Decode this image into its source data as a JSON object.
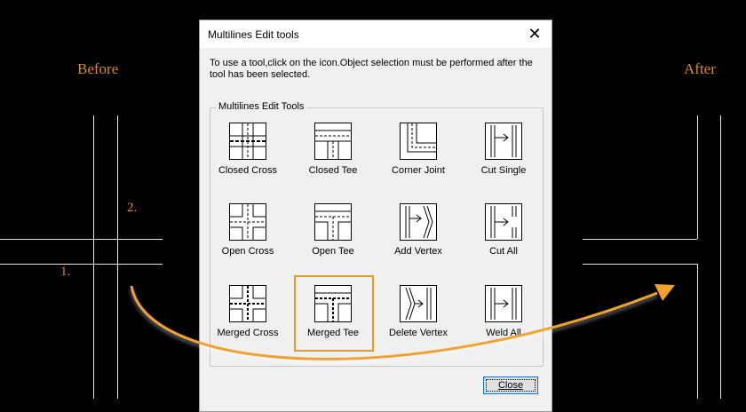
{
  "labels": {
    "before": "Before",
    "after": "After",
    "step1": "1.",
    "step2": "2."
  },
  "dialog": {
    "title": "Multilines Edit tools",
    "close_glyph": "✕",
    "instructions": "To use a tool,click on the icon.Object selection must be performed after the tool has been selected.",
    "group_label": "Multilines Edit Tools",
    "tools": [
      {
        "label": "Closed Cross",
        "icon": "closed-cross-icon"
      },
      {
        "label": "Closed Tee",
        "icon": "closed-tee-icon"
      },
      {
        "label": "Corner Joint",
        "icon": "corner-joint-icon"
      },
      {
        "label": "Cut Single",
        "icon": "cut-single-icon"
      },
      {
        "label": "Open Cross",
        "icon": "open-cross-icon"
      },
      {
        "label": "Open Tee",
        "icon": "open-tee-icon"
      },
      {
        "label": "Add Vertex",
        "icon": "add-vertex-icon"
      },
      {
        "label": "Cut All",
        "icon": "cut-all-icon"
      },
      {
        "label": "Merged Cross",
        "icon": "merged-cross-icon"
      },
      {
        "label": "Merged Tee",
        "icon": "merged-tee-icon"
      },
      {
        "label": "Delete Vertex",
        "icon": "delete-vertex-icon"
      },
      {
        "label": "Weld All",
        "icon": "weld-all-icon"
      }
    ],
    "selected_tool": "Merged Tee",
    "close_button": "Close"
  },
  "colors": {
    "accent": "#d98b2b",
    "highlight": "#e39a2a",
    "background": "#000000",
    "dialog_bg": "#f0f0f0"
  }
}
